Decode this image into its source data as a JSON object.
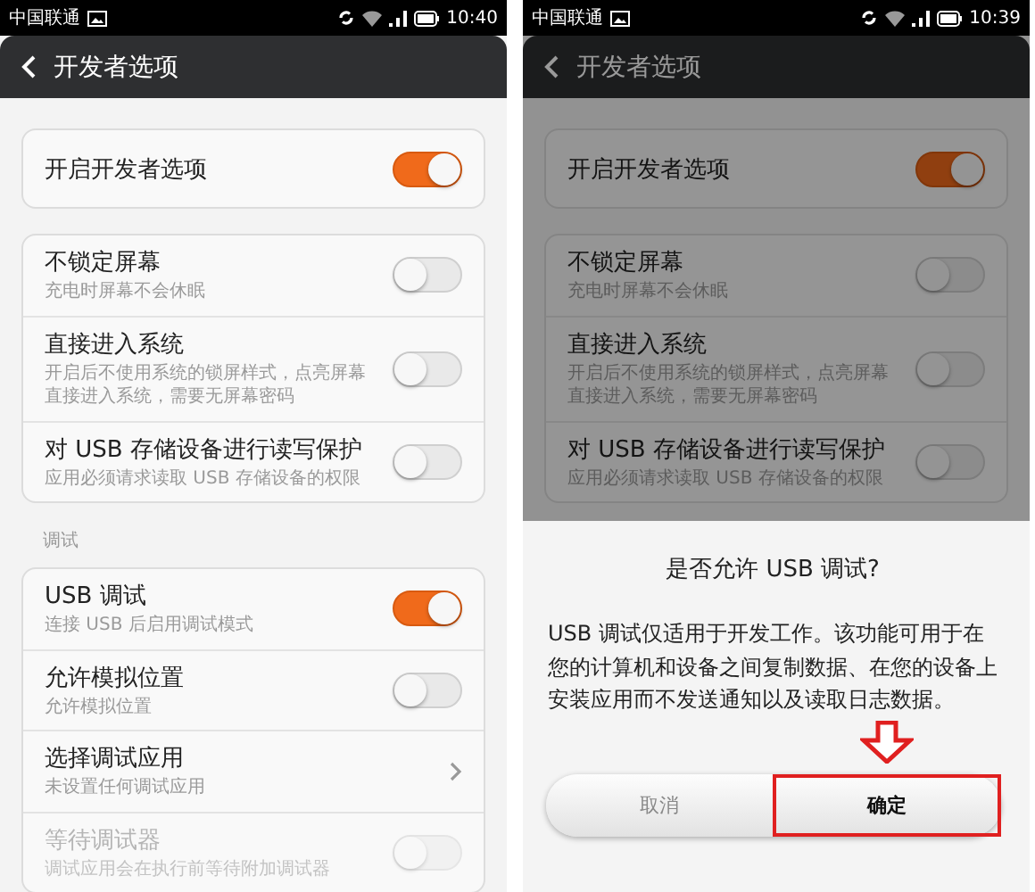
{
  "screens": [
    {
      "status_bar": {
        "carrier": "中国联通",
        "time": "10:40"
      },
      "header": {
        "title": "开发者选项"
      },
      "dimmed": false,
      "sections": [
        {
          "items": [
            {
              "kind": "toggle",
              "title": "开启开发者选项",
              "on": true,
              "disabled": false
            }
          ]
        },
        {
          "items": [
            {
              "kind": "toggle",
              "title": "不锁定屏幕",
              "subtitle": "充电时屏幕不会休眠",
              "on": false,
              "disabled": false
            },
            {
              "kind": "toggle",
              "title": "直接进入系统",
              "subtitle": "开启后不使用系统的锁屏样式，点亮屏幕直接进入系统，需要无屏幕密码",
              "on": false,
              "disabled": false
            },
            {
              "kind": "toggle",
              "title": "对 USB 存储设备进行读写保护",
              "subtitle": "应用必须请求读取 USB 存储设备的权限",
              "on": false,
              "disabled": false
            }
          ]
        },
        {
          "label": "调试",
          "items": [
            {
              "kind": "toggle",
              "title": "USB 调试",
              "subtitle": "连接 USB 后启用调试模式",
              "on": true,
              "disabled": false
            },
            {
              "kind": "toggle",
              "title": "允许模拟位置",
              "subtitle": "允许模拟位置",
              "on": false,
              "disabled": false
            },
            {
              "kind": "link",
              "title": "选择调试应用",
              "subtitle": "未设置任何调试应用",
              "disabled": false
            },
            {
              "kind": "toggle",
              "title": "等待调试器",
              "subtitle": "调试应用会在执行前等待附加调试器",
              "on": false,
              "disabled": true
            }
          ]
        }
      ]
    },
    {
      "status_bar": {
        "carrier": "中国联通",
        "time": "10:39"
      },
      "header": {
        "title": "开发者选项"
      },
      "dimmed": true,
      "sections": [
        {
          "items": [
            {
              "kind": "toggle",
              "title": "开启开发者选项",
              "on": true,
              "disabled": false
            }
          ]
        },
        {
          "items": [
            {
              "kind": "toggle",
              "title": "不锁定屏幕",
              "subtitle": "充电时屏幕不会休眠",
              "on": false,
              "disabled": false
            },
            {
              "kind": "toggle",
              "title": "直接进入系统",
              "subtitle": "开启后不使用系统的锁屏样式，点亮屏幕直接进入系统，需要无屏幕密码",
              "on": false,
              "disabled": false
            },
            {
              "kind": "toggle",
              "title": "对 USB 存储设备进行读写保护",
              "subtitle": "应用必须请求读取 USB 存储设备的权限",
              "on": false,
              "disabled": false
            }
          ]
        }
      ],
      "dialog": {
        "title": "是否允许 USB 调试?",
        "message": "USB 调试仅适用于开发工作。该功能可用于在您的计算机和设备之间复制数据、在您的设备上安装应用而不发送通知以及读取日志数据。",
        "buttons": [
          {
            "label": "取消",
            "primary": false,
            "highlighted": false
          },
          {
            "label": "确定",
            "primary": true,
            "highlighted": true
          }
        ]
      }
    }
  ]
}
